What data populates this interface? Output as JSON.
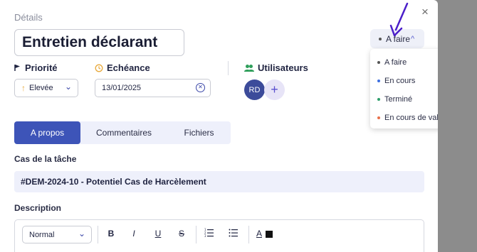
{
  "dialog": {
    "section_heading": "Détails",
    "title_value": "Entretien déclarant",
    "close_symbol": "×"
  },
  "status": {
    "current": "A faire",
    "options": [
      {
        "label": "A faire",
        "color": "#555555"
      },
      {
        "label": "En cours",
        "color": "#3d6fe0"
      },
      {
        "label": "Terminé",
        "color": "#2e9e6a"
      },
      {
        "label": "En cours de validation",
        "color": "#e8704a"
      }
    ]
  },
  "fields": {
    "priority_label": "Priorité",
    "priority_value": "Elevée",
    "due_label": "Echéance",
    "due_value": "13/01/2025",
    "users_label": "Utilisateurs",
    "user_initials": "RD"
  },
  "tabs": [
    {
      "label": "A propos",
      "active": true
    },
    {
      "label": "Commentaires",
      "active": false
    },
    {
      "label": "Fichiers",
      "active": false
    }
  ],
  "case": {
    "label": "Cas de la tâche",
    "value": "#DEM-2024-10 - Potentiel Cas de Harcèlement"
  },
  "description": {
    "label": "Description",
    "format_value": "Normal",
    "toolbar": {
      "bold": "B",
      "italic": "I",
      "underline": "U",
      "strike": "S",
      "color_text": "A"
    }
  },
  "colors": {
    "accent": "#3d54b8",
    "annotation_arrow": "#4b1fc9",
    "priority_arrow": "#e8a93b",
    "users_icon": "#2e9e5a",
    "due_icon": "#e8a93b"
  }
}
